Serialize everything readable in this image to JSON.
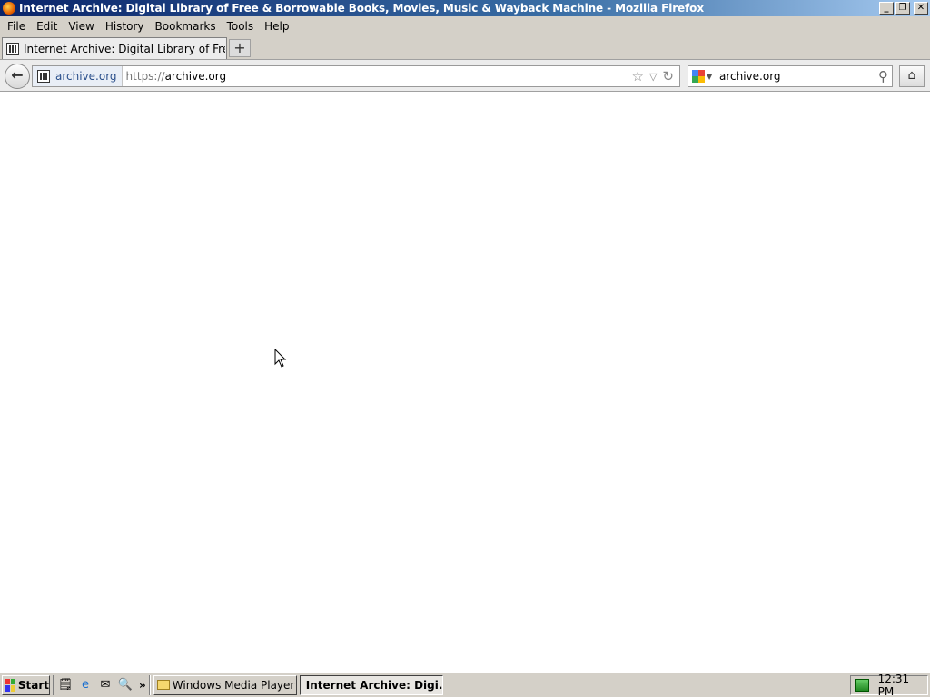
{
  "window": {
    "title": "Internet Archive: Digital Library of Free & Borrowable Books, Movies, Music & Wayback Machine - Mozilla Firefox",
    "minimize": "_",
    "restore": "❐",
    "close": "✕"
  },
  "menu": {
    "file": "File",
    "edit": "Edit",
    "view": "View",
    "history": "History",
    "bookmarks": "Bookmarks",
    "tools": "Tools",
    "help": "Help"
  },
  "tabs": {
    "active_label": "Internet Archive: Digital Library of Free & Borro...",
    "new_tab": "+"
  },
  "navbar": {
    "back": "←",
    "identity_domain": "archive.org",
    "url_scheme": "https://",
    "url_rest": "archive.org",
    "star": "☆",
    "dropdown": "▽",
    "reload": "↻",
    "search_value": "archive.org",
    "search_go": "⚲",
    "home": "⌂"
  },
  "taskbar": {
    "start": "Start",
    "ql_more": "»",
    "task1": "Windows Media Player",
    "task2": "Internet Archive: Digi...",
    "clock": "12:31 PM"
  }
}
